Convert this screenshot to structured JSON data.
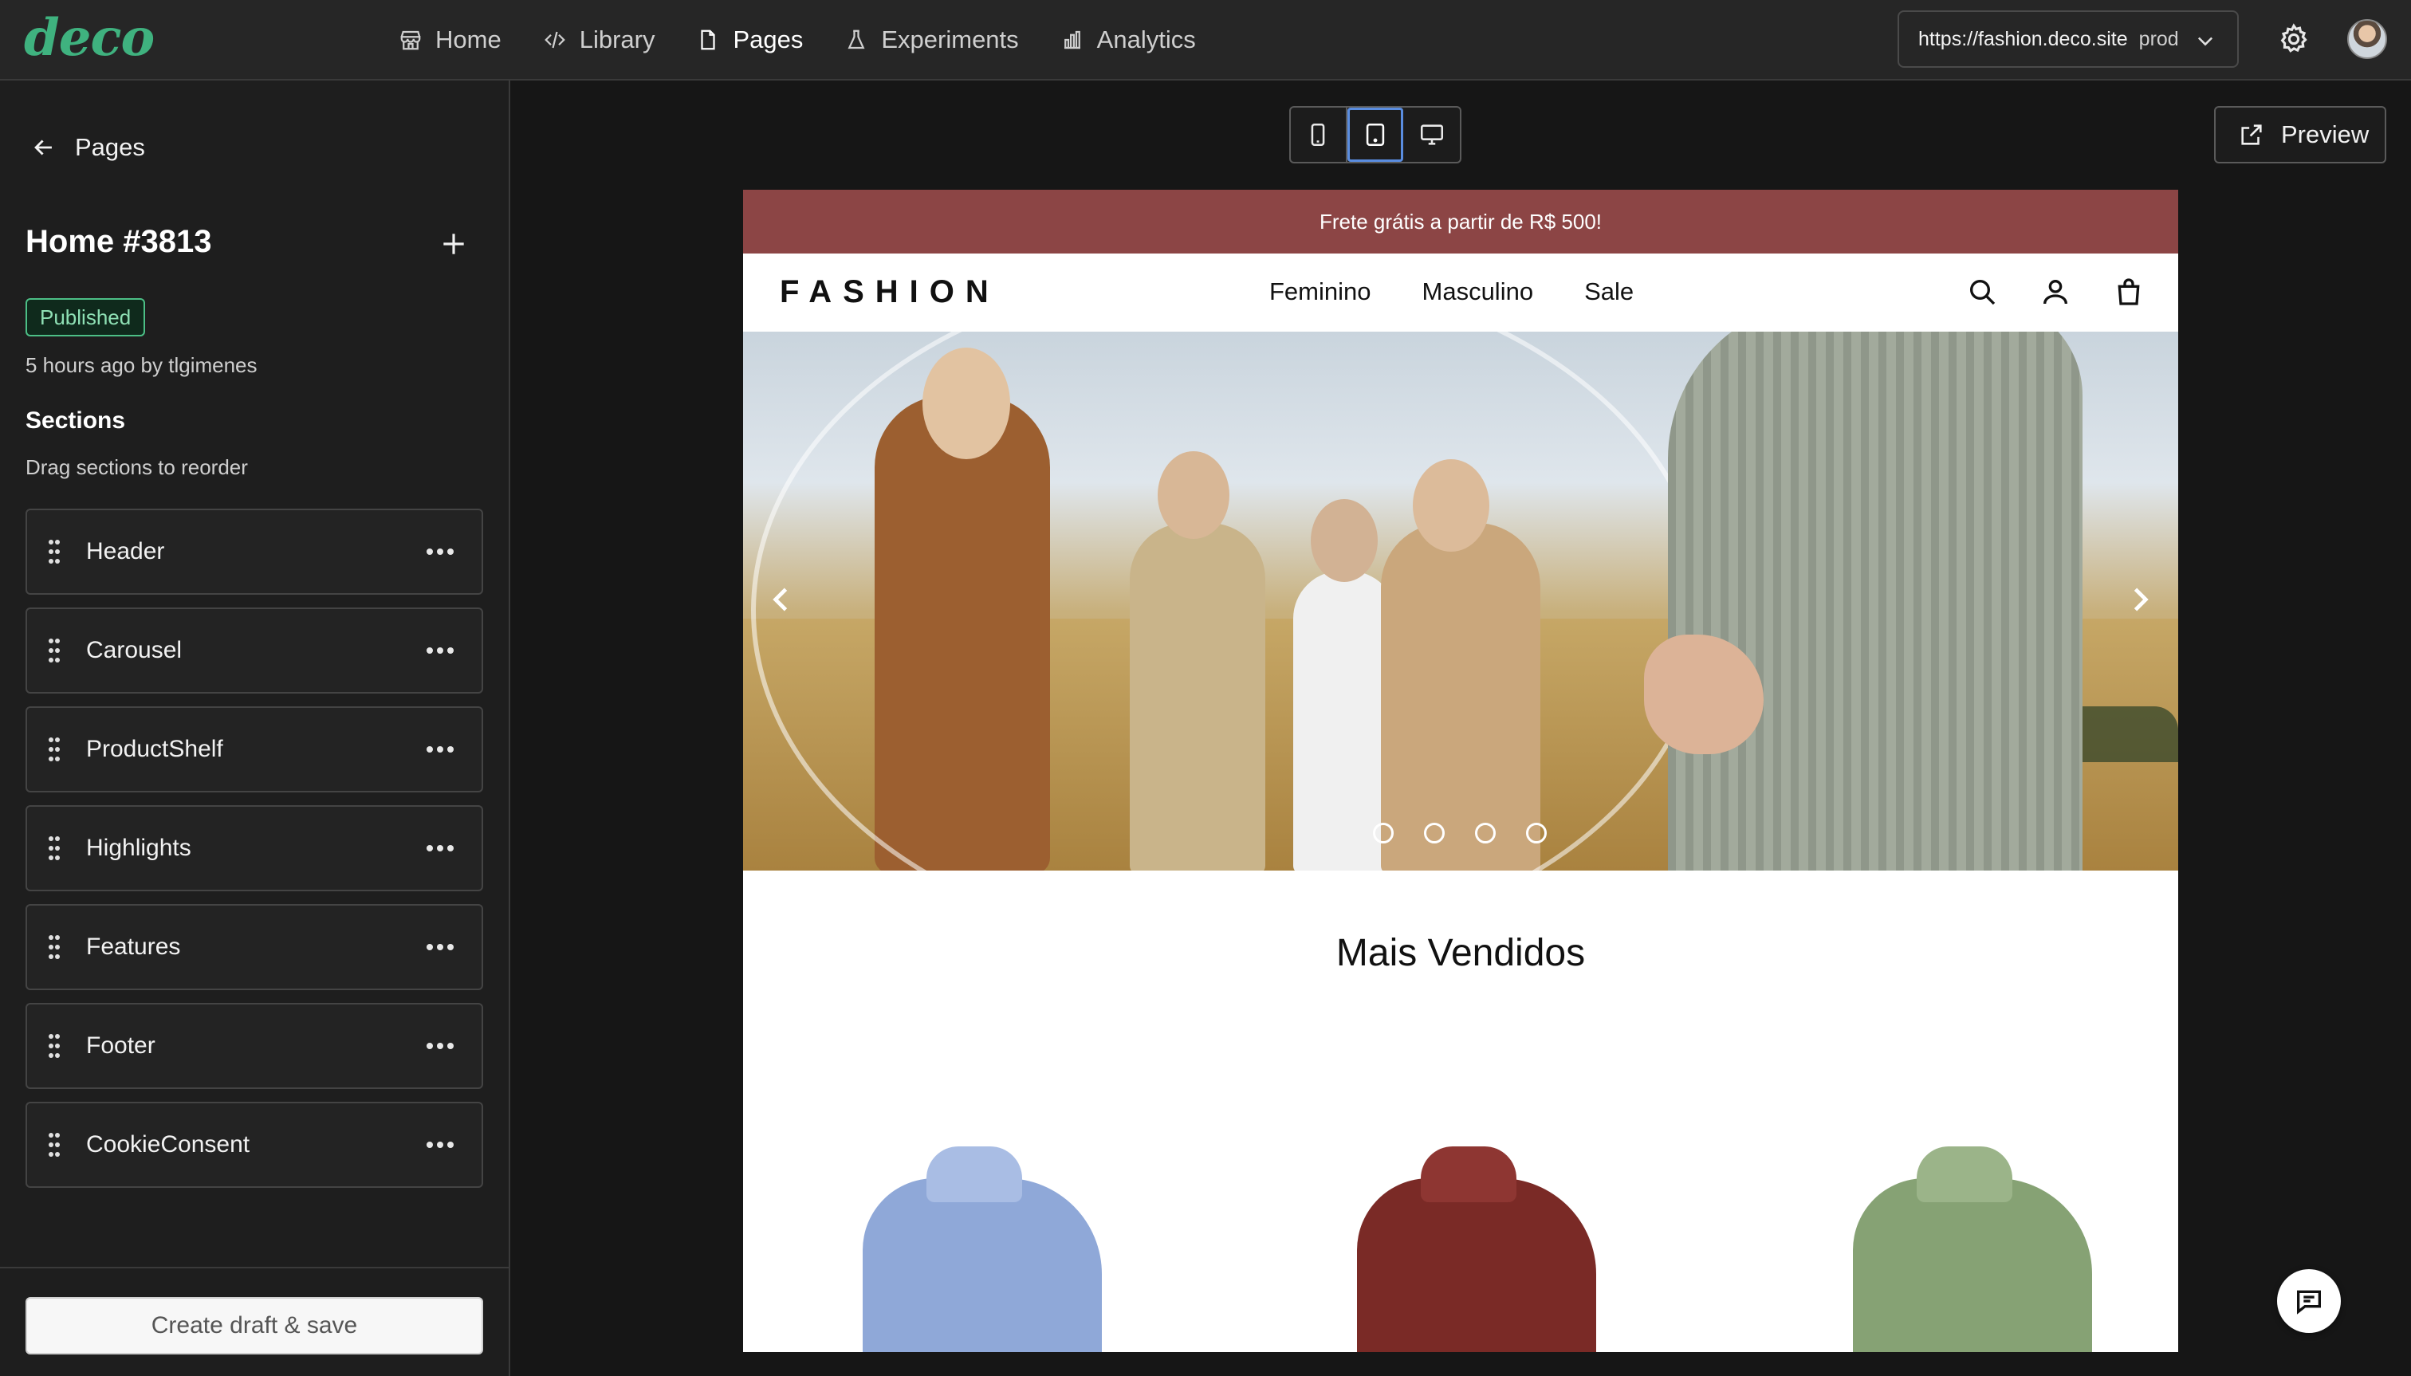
{
  "app": {
    "logo": "deco",
    "nav": [
      {
        "label": "Home",
        "icon": "store-icon"
      },
      {
        "label": "Library",
        "icon": "code-icon"
      },
      {
        "label": "Pages",
        "icon": "file-icon",
        "active": true
      },
      {
        "label": "Experiments",
        "icon": "flask-icon"
      },
      {
        "label": "Analytics",
        "icon": "bar-chart-icon"
      }
    ],
    "site_selector": {
      "url": "https://fashion.deco.site",
      "env": "prod"
    }
  },
  "panel": {
    "back_label": "Pages",
    "page_title": "Home #3813",
    "status_badge": "Published",
    "meta": "5 hours ago by tlgimenes",
    "sections_title": "Sections",
    "sections_hint": "Drag sections to reorder",
    "sections": [
      {
        "label": "Header"
      },
      {
        "label": "Carousel"
      },
      {
        "label": "ProductShelf"
      },
      {
        "label": "Highlights"
      },
      {
        "label": "Features"
      },
      {
        "label": "Footer"
      },
      {
        "label": "CookieConsent"
      }
    ],
    "create_button": "Create draft & save"
  },
  "canvas": {
    "viewport_modes": [
      "mobile",
      "tablet",
      "desktop"
    ],
    "active_viewport": "tablet",
    "preview_label": "Preview"
  },
  "site": {
    "promo": "Frete grátis a partir de R$ 500!",
    "brand": "FASHION",
    "nav": [
      "Feminino",
      "Masculino",
      "Sale"
    ],
    "carousel_slides": 4,
    "shelf_title": "Mais Vendidos",
    "products": [
      {
        "color": "#8fa8d8"
      },
      {
        "color": "#7a2a26"
      },
      {
        "color": "#86a274"
      }
    ]
  },
  "colors": {
    "accent": "#3fb27f",
    "promo_bg": "#8c4545",
    "badge_green": "#4cbf86",
    "active_outline": "#5a8de0"
  }
}
